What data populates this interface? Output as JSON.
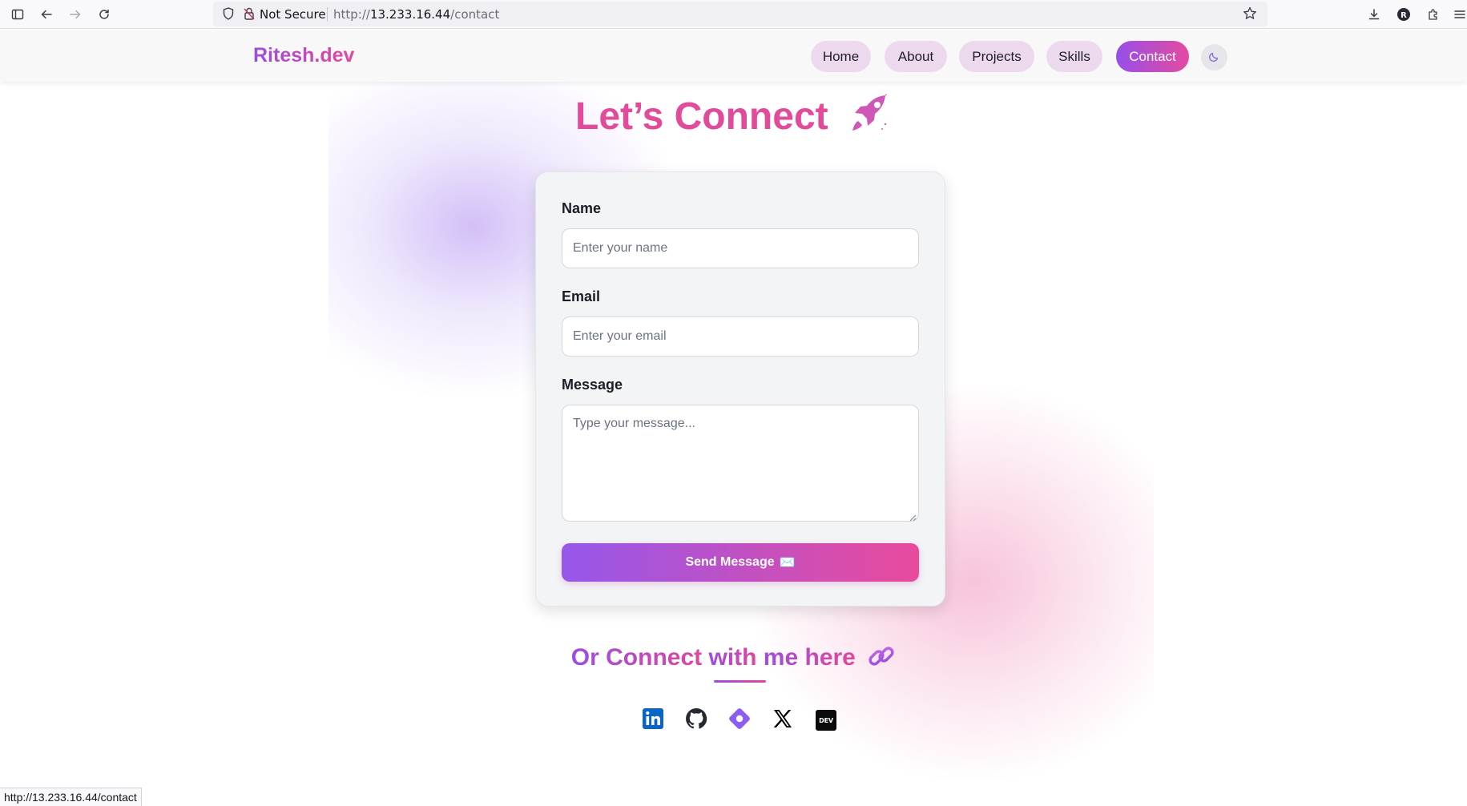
{
  "browser": {
    "security_label": "Not Secure",
    "url_prefix": "http://",
    "url_host": "13.233.16.44",
    "url_path": "/contact",
    "icons": [
      "sidebar-icon",
      "back-icon",
      "forward-icon",
      "reload-icon",
      "shield-icon",
      "lock-icon",
      "star-icon",
      "download-icon",
      "account-icon",
      "extensions-icon",
      "menu-icon"
    ]
  },
  "nav": {
    "brand": "Ritesh.dev",
    "items": [
      {
        "label": "Home",
        "active": false
      },
      {
        "label": "About",
        "active": false
      },
      {
        "label": "Projects",
        "active": false
      },
      {
        "label": "Skills",
        "active": false
      },
      {
        "label": "Contact",
        "active": true
      }
    ],
    "theme_toggle_icon": "moon-icon"
  },
  "contact": {
    "heading": "Let’s Connect",
    "heading_icon": "rocket-icon",
    "form": {
      "name_label": "Name",
      "name_placeholder": "Enter your name",
      "email_label": "Email",
      "email_placeholder": "Enter your email",
      "message_label": "Message",
      "message_placeholder": "Type your message...",
      "submit_label": "Send Message",
      "submit_icon": "✉️"
    },
    "social_heading_part1": "Or Connect ",
    "social_heading_part2": "with",
    "social_heading_part3": " me here",
    "social_heading_icon": "link-icon",
    "social_links": [
      "linkedin-icon",
      "github-icon",
      "diamond-icon",
      "x-icon",
      "dev-icon"
    ],
    "dev_badge": "DEV"
  },
  "status_bar": {
    "text": "http://13.233.16.44/contact"
  },
  "colors": {
    "accent_purple": "#9650e8",
    "accent_pink": "#e54aa0",
    "heading_pink": "#e24a9a",
    "nav_pill": "#ecd9ee",
    "linkedin_blue": "#0a66c2"
  }
}
